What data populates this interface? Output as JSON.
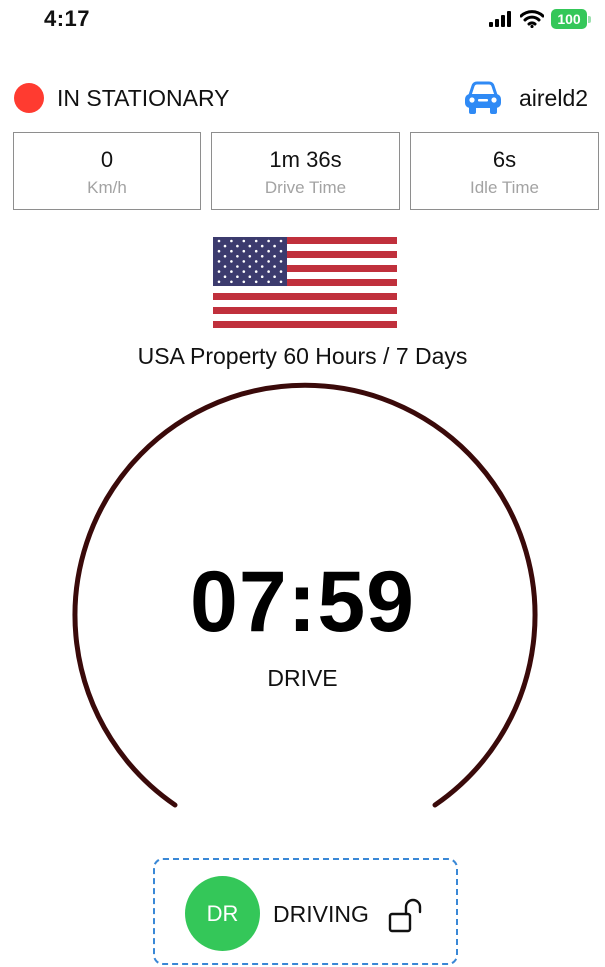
{
  "status_bar": {
    "time": "4:17",
    "battery": "100",
    "icons": [
      "signal-icon",
      "wifi-icon",
      "battery-icon"
    ]
  },
  "header": {
    "state_label": "IN STATIONARY",
    "state_color": "#ff3b30",
    "vehicle_icon": "car-icon",
    "vehicle_name": "aireld2",
    "accent_color": "#2f8af5"
  },
  "stats": [
    {
      "value": "0",
      "label": "Km/h"
    },
    {
      "value": "1m 36s",
      "label": "Drive Time"
    },
    {
      "value": "6s",
      "label": "Idle Time"
    }
  ],
  "rule": {
    "flag": "usa-flag-icon",
    "label": "USA Property 60 Hours / 7 Days"
  },
  "gauge": {
    "time": "07:59",
    "mode": "DRIVE",
    "ring_color": "#3a0a0a"
  },
  "driver": {
    "initials": "DR",
    "status": "DRIVING",
    "avatar_color": "#34c759",
    "lock_icon": "unlock-icon"
  }
}
